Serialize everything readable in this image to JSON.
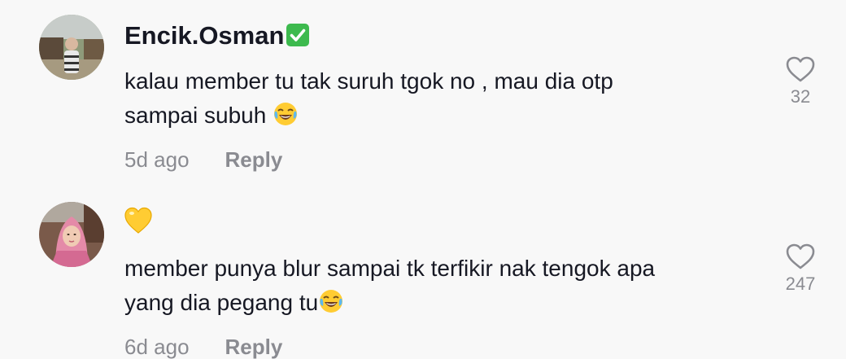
{
  "comments": [
    {
      "username": "Encik.Osman",
      "badge_icon": "verified-check-icon",
      "text_line1": "kalau member tu tak suruh tgok no , mau dia otp",
      "text_line2": "sampai subuh",
      "text_emoji": "tears-of-joy-emoji",
      "time": "5d ago",
      "reply_label": "Reply",
      "like_count": "32"
    },
    {
      "header_emoji": "yellow-heart-emoji",
      "text_line1": "member punya blur sampai tk terfikir nak tengok apa",
      "text_line2": "yang dia pegang tu",
      "text_emoji": "tears-of-joy-emoji",
      "time": "6d ago",
      "reply_label": "Reply",
      "like_count": "247"
    }
  ],
  "colors": {
    "background": "#f8f8f8",
    "text": "#161823",
    "muted": "#8a8b91",
    "badge_green": "#3dba4e",
    "yellow_heart": "#ffcc33"
  }
}
